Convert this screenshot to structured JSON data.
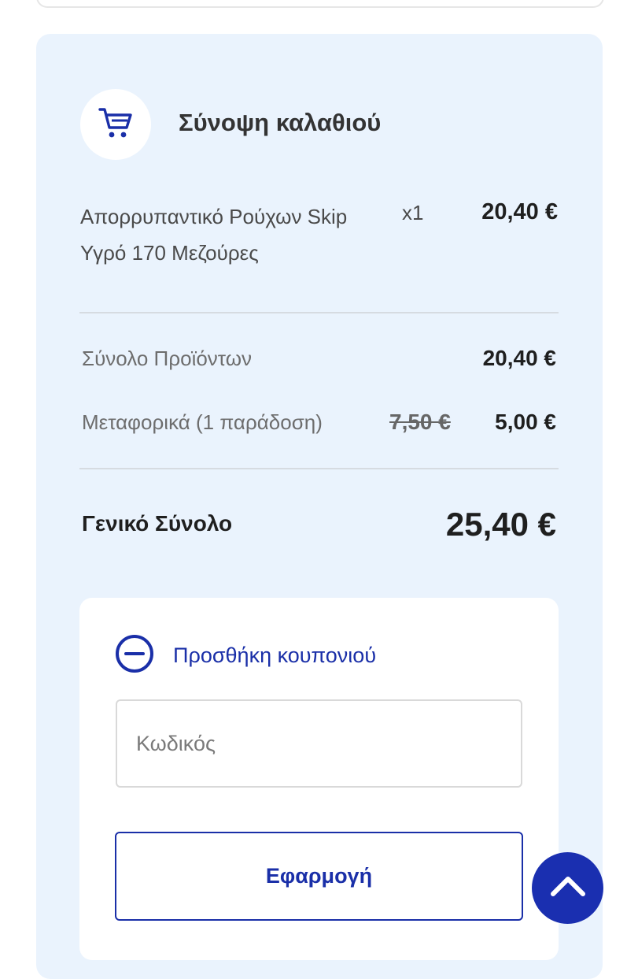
{
  "summary": {
    "title": "Σύνοψη καλαθιού",
    "cart_icon": "shopping-cart-icon"
  },
  "item": {
    "name": "Απορρυπαντικό Ρούχων Skip Υγρό 170 Μεζούρες",
    "quantity": "x1",
    "price": "20,40 €"
  },
  "totals": {
    "products_label": "Σύνολο Προϊόντων",
    "products_value": "20,40 €",
    "shipping_label": "Μεταφορικά (1 παράδοση)",
    "shipping_old_value": "7,50 €",
    "shipping_value": "5,00 €",
    "grand_label": "Γενικό Σύνολο",
    "grand_value": "25,40 €"
  },
  "coupon": {
    "toggle_icon": "minus-circle-icon",
    "toggle_label": "Προσθήκη κουπονιού",
    "code_placeholder": "Κωδικός",
    "code_value": "",
    "apply_label": "Εφαρμογή"
  },
  "scroll_top_icon": "chevron-up-icon",
  "colors": {
    "panel_background": "#eaf3fd",
    "accent": "#1a2fa8",
    "text_dark": "#1f1f1f",
    "text_muted": "#6d6d6d"
  }
}
